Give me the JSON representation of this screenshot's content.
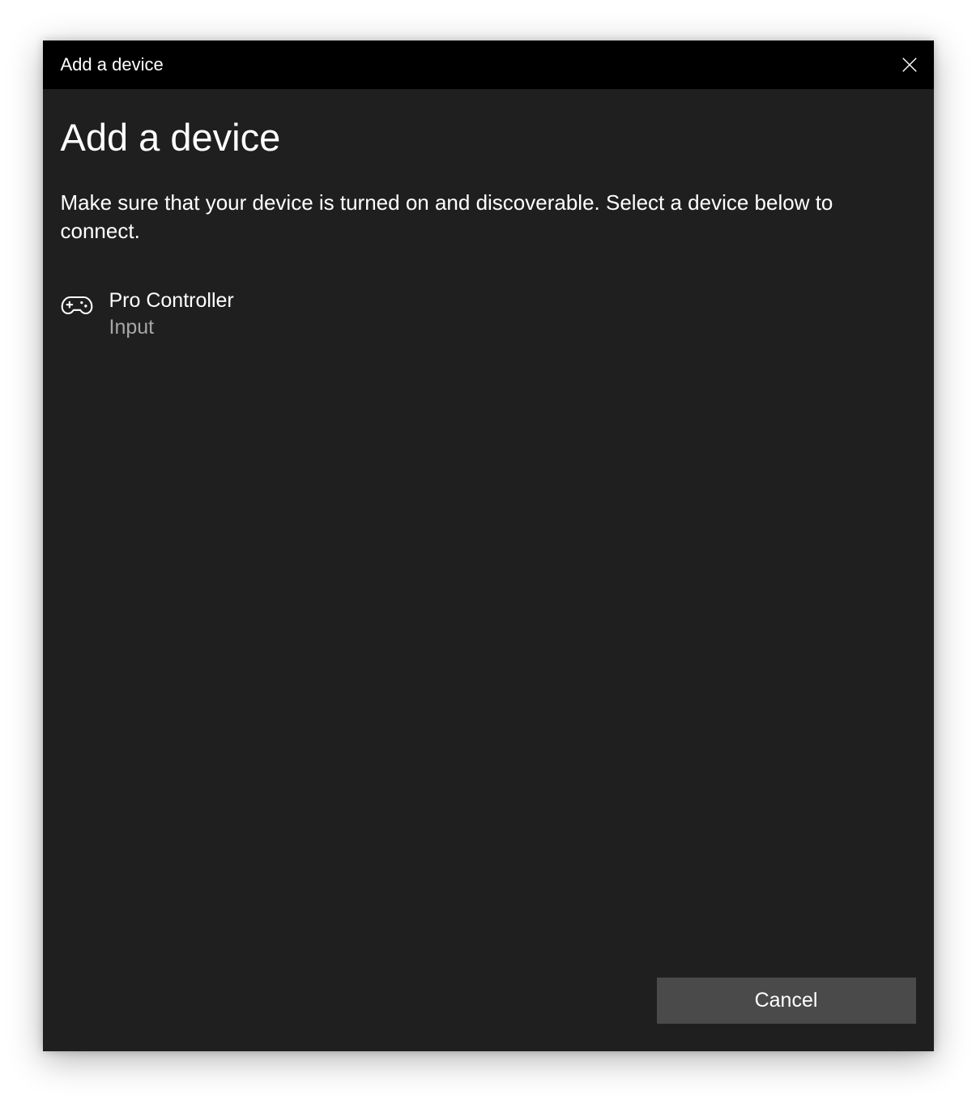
{
  "titlebar": {
    "title": "Add a device"
  },
  "content": {
    "heading": "Add a device",
    "instruction": "Make sure that your device is turned on and discoverable. Select a device below to connect."
  },
  "devices": [
    {
      "name": "Pro Controller",
      "type": "Input",
      "icon": "gamepad-icon"
    }
  ],
  "footer": {
    "cancel_label": "Cancel"
  }
}
